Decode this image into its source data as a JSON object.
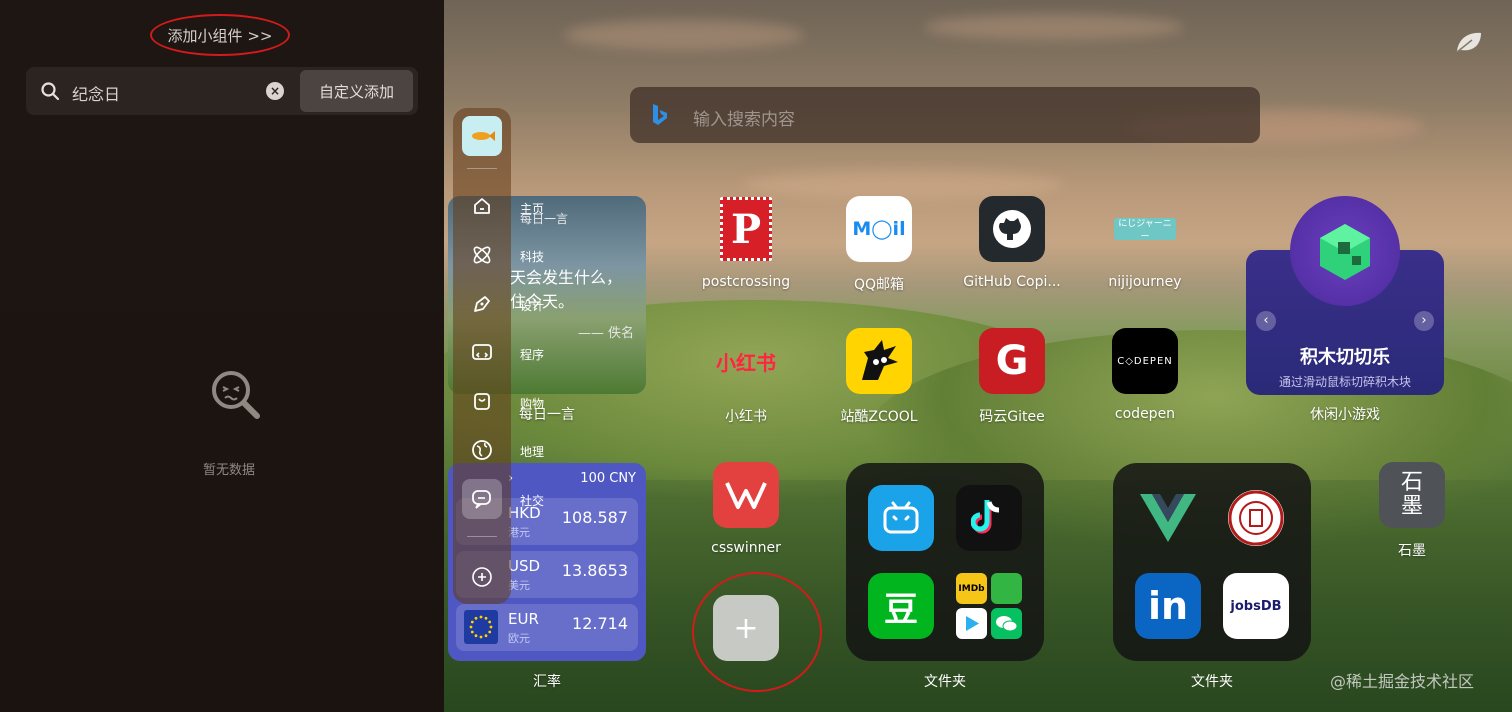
{
  "sidebar": {
    "add_widget_label": "添加小组件 >>",
    "search_value": "纪念日",
    "clear_label": "×",
    "custom_add_label": "自定义添加",
    "empty_text": "暂无数据"
  },
  "search": {
    "placeholder": "输入搜索内容"
  },
  "nav": {
    "items": [
      {
        "label": "主页",
        "icon": "home-icon"
      },
      {
        "label": "科技",
        "icon": "atom-icon"
      },
      {
        "label": "设计",
        "icon": "pen-icon"
      },
      {
        "label": "程序",
        "icon": "code-icon"
      },
      {
        "label": "购物",
        "icon": "bag-icon"
      },
      {
        "label": "地理",
        "icon": "globe-icon"
      },
      {
        "label": "社交",
        "icon": "chat-icon"
      }
    ]
  },
  "quote_widget": {
    "title": "每日一言",
    "line1": "天会发生什么，",
    "line2": "住今天。",
    "author": "—— 佚名",
    "label": "每日一言"
  },
  "fx_widget": {
    "base": "100 CNY",
    "arrow": "›",
    "rows": [
      {
        "code": "HKD",
        "name": "港元",
        "value": "108.587"
      },
      {
        "code": "USD",
        "name": "美元",
        "value": "13.8653"
      },
      {
        "code": "EUR",
        "name": "欧元",
        "value": "12.714"
      }
    ],
    "label": "汇率"
  },
  "apps": [
    {
      "name": "postcrossing",
      "color": "#d61f26"
    },
    {
      "name": "QQ邮箱",
      "color": "#ffffff"
    },
    {
      "name": "GitHub Copi...",
      "color": "#24292e"
    },
    {
      "name": "nijijourney",
      "color": "#6fc7c5"
    },
    {
      "name": "小红书",
      "color": "#ff2442"
    },
    {
      "name": "站酷ZCOOL",
      "color": "#ffd400"
    },
    {
      "name": "码云Gitee",
      "color": "#c71d23"
    },
    {
      "name": "codepen",
      "color": "#000000"
    },
    {
      "name": "csswinner",
      "color": "#e34140"
    },
    {
      "name": "石墨",
      "color": "#4f5257"
    }
  ],
  "tile_text": {
    "postcrossing": "P",
    "qqmail": "M◯il",
    "xiaohongshu": "小红书",
    "codepen": "C◇DEPEN",
    "gitee": "G",
    "shimo": "石\n墨",
    "douban": "豆",
    "linkedin": "in",
    "jobsdb": "jobsDB",
    "imdb": "IMDb",
    "nijijourney": "にじジャーニー"
  },
  "game_widget": {
    "title": "积木切切乐",
    "subtitle": "通过滑动鼠标切碎积木块",
    "label": "休闲小游戏",
    "prev": "‹",
    "next": "›"
  },
  "folders": [
    {
      "label": "文件夹"
    },
    {
      "label": "文件夹"
    }
  ],
  "add_tile": "+",
  "watermark": "@稀土掘金技术社区"
}
